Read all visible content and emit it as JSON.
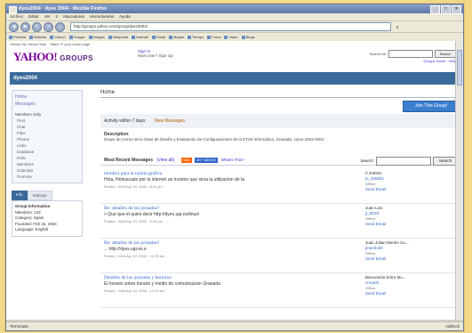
{
  "browser": {
    "title": "dyes2004 · dyes 2004 - Mozilla Firefox",
    "menu": [
      "Archivo",
      "Editar",
      "Ver",
      "Ir",
      "Marcadores",
      "Herramientas",
      "Ayuda"
    ],
    "url": "http://groups.yahoo.com/group/dyes2004/",
    "go_label": "Ir",
    "bookmarks": [
      "Portada",
      "Noticias",
      "Yahoo!",
      "Google",
      "Images",
      "Wikipedia",
      "Hotmail",
      "Gmail",
      "Mapas",
      "Tiempo",
      "Foros",
      "Video",
      "Blogs"
    ],
    "status_left": "Terminado",
    "status_right": "Adblock"
  },
  "yahoo": {
    "top_links": [
      "Yahoo! My Yahoo! Mail",
      "Make Y! your home page"
    ],
    "logo": "YAHOO!",
    "logo_suffix": "GROUPS",
    "sign_in": "Sign In",
    "sign_in_sub": "New User? Sign Up",
    "search_label": "Search for:",
    "search_button": "Search",
    "help_links": "Groups Home · Help"
  },
  "group": {
    "name": "dyes2004"
  },
  "sidebar": {
    "nav": [
      "Home",
      "Messages"
    ],
    "members_only_label": "Members Only",
    "members_items": [
      "Post",
      "Chat",
      "Files",
      "Photos",
      "Links",
      "Database",
      "Polls",
      "Members",
      "Calendar",
      "Promote"
    ],
    "info_tab": "Info",
    "settings_tab": "Settings",
    "info_title": "Group Information",
    "info_lines": [
      "Members: 142",
      "Category: Spain",
      "Founded: Feb 16, 2004",
      "Language: English"
    ]
  },
  "main": {
    "heading": "Home",
    "join_button": "Join This Group!",
    "activity_label": "Activity within 7 days:",
    "new_messages": "New Messages",
    "description_heading": "Description",
    "description_text": "Grupo de correo de la clase de Diseño y Evaluación de Configuraciones de la ETSII Informática, Granada, curso 2003-2004.",
    "recent_heading": "Most Recent Messages",
    "view_all": "(view all)",
    "xml_badge": "XML",
    "myyahoo_badge": "MY YAHOO!",
    "whats_this": "What's This?",
    "search_label": "Search:",
    "search_button": "Search"
  },
  "messages": [
    {
      "subject": "monitor para la tarjeta grafica",
      "body": "Hola, Hebuscado por la internet un monitor que sirva la utilizacion de la",
      "posted": "Posted - Wed Apr 19, 2006 - 8:11 pm",
      "author": "rl 200501",
      "profile": "jo_200501",
      "status": "Offline",
      "send_email": "Send Email"
    },
    {
      "subject": "Re: detalles de las jornadas?",
      "body": "> Que que el quien decir http://dyes.ugr.es/linux/",
      "posted": "Posted - Wed Apr 19, 2006 - 5:26 pm",
      "author": "Juan Luis",
      "profile": "jl_IDOS",
      "status": "Offline",
      "send_email": "Send Email"
    },
    {
      "subject": "Re: detalles de las jornadas?",
      "body": "... http://dyes.ugr.es.e",
      "posted": "Posted - Wed Apr 19, 2006 - 12:05 am",
      "author": "Juan Julian Merelo Gu...",
      "profile": "jmerelo00",
      "status": "Offline",
      "send_email": "Send Email"
    },
    {
      "subject": "Detalles de las jornadas y horarios",
      "body": "El horario sobre horario y medio de comunicacion Granada",
      "posted": "Posted - Wed Apr 18, 2006 - 12:03 am",
      "author": "Bienvenido Entre Mo...",
      "profile": "crmarrk",
      "status": "Offline",
      "send_email": "Send Email"
    }
  ]
}
